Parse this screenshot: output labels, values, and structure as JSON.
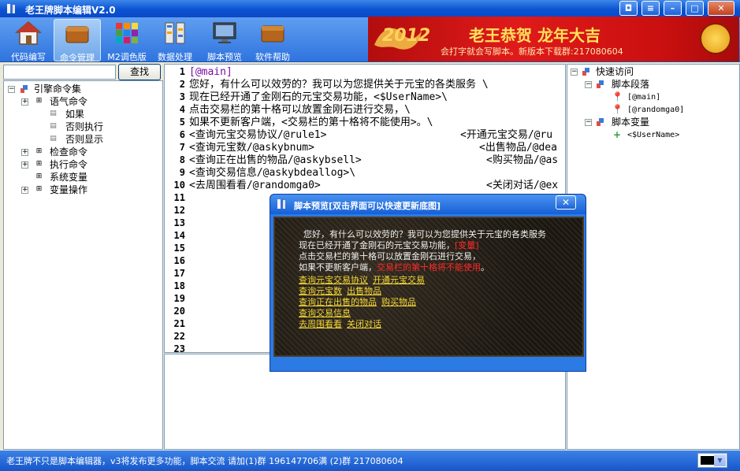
{
  "window": {
    "title": "老王牌脚本编辑V2.0"
  },
  "toolbar": {
    "items": [
      {
        "label": "代码编写",
        "icon": "house-icon"
      },
      {
        "label": "命令管理",
        "icon": "wallet-icon"
      },
      {
        "label": "M2调色版",
        "icon": "palette-icon"
      },
      {
        "label": "数据处理",
        "icon": "data-icon"
      },
      {
        "label": "脚本预览",
        "icon": "monitor-icon"
      },
      {
        "label": "软件帮助",
        "icon": "help-wallet-icon"
      }
    ]
  },
  "banner": {
    "year": "2012",
    "headline": "老王恭贺  龙年大吉",
    "sub": "会打字就会写脚本。新版本下载群:217080604"
  },
  "search": {
    "value": "",
    "button": "查找"
  },
  "left_tree": {
    "root": "引擎命令集",
    "items": [
      {
        "label": "语气命令"
      },
      {
        "label": "如果"
      },
      {
        "label": "否则执行"
      },
      {
        "label": "否则显示"
      },
      {
        "label": "检查命令"
      },
      {
        "label": "执行命令"
      },
      {
        "label": "系统变量"
      },
      {
        "label": "变量操作"
      }
    ]
  },
  "editor": {
    "line_numbers": [
      "1",
      "2",
      "3",
      "4",
      "5",
      "6",
      "7",
      "8",
      "9",
      "10",
      "11",
      "12",
      "13",
      "14",
      "15",
      "16",
      "17",
      "18",
      "19",
      "20",
      "21",
      "22",
      "23"
    ],
    "lines": [
      "[@main]",
      "您好，有什么可以效劳的？我可以为您提供关于元宝的各类服务 \\",
      "现在已经开通了金刚石的元宝交易功能，<$UserName>\\",
      "点击交易栏的第十格可以放置金刚石进行交易，\\",
      "如果不更新客户端，<交易栏的第十格将不能使用>。\\",
      "<查询元宝交易协议/@rule1>",
      "<查询元宝数/@askybnum>",
      "<查询正在出售的物品/@askybsell>",
      "<查询交易信息/@askybdeallog>\\",
      "<去周围看看/@randomga0>"
    ],
    "lines_right": [
      "<开通元宝交易/@ru",
      "<出售物品/@dea",
      "<购买物品/@as",
      "<关闭对话/@ex"
    ]
  },
  "right_tree": {
    "root": "快速访问",
    "groups": [
      {
        "label": "脚本段落",
        "items": [
          "[@main]",
          "[@randomga0]"
        ]
      },
      {
        "label": "脚本变量",
        "items": [
          "<$UserName>"
        ]
      }
    ]
  },
  "preview": {
    "title": "脚本预览[双击界面可以快速更新底图]",
    "close": "✕",
    "lines": [
      "您好，有什么可以效劳的？我可以为您提供关于元宝的各类服务",
      "现在已经开通了金刚石的元宝交易功能，",
      "[变量]",
      "点击交易栏的第十格可以放置金刚石进行交易，",
      "如果不更新客户端，",
      "交易栏的第十格将不能使用",
      "。"
    ],
    "links": [
      [
        "查询元宝交易协议",
        "开通元宝交易"
      ],
      [
        "查询元宝数",
        "出售物品"
      ],
      [
        "查询正在出售的物品",
        "购买物品"
      ],
      [
        "查询交易信息"
      ],
      [
        "去周围看看",
        "关闭对话"
      ]
    ]
  },
  "status": {
    "text": "老王牌不只是脚本编辑器，v3将发布更多功能，脚本交流 请加(1)群 196147706满  (2)群 217080604"
  },
  "colors": {
    "accent": "#0a53d3",
    "label_purple": "#7a0ca8",
    "link_yellow": "#f5d836",
    "warn_red": "#ff2a2a"
  }
}
